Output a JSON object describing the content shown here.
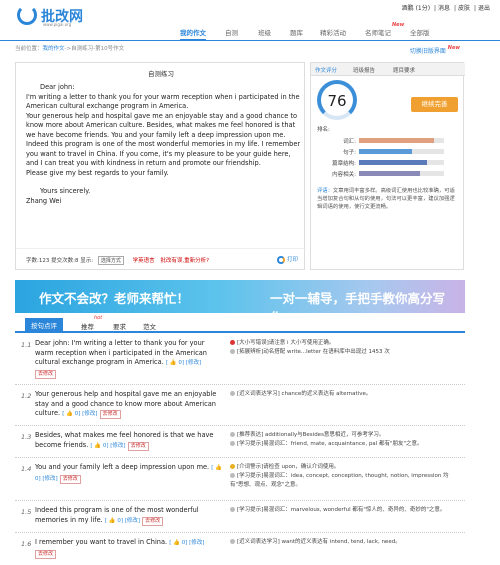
{
  "logo": {
    "text": "批改网",
    "url": "www.pigai.org"
  },
  "userbar": {
    "username": "酒鹏",
    "coins": "(1分)",
    "items": [
      "消息",
      "皮肤",
      "退出"
    ]
  },
  "nav": {
    "items": [
      "我的作文",
      "自测",
      "班级",
      "题库",
      "精彩活动",
      "名师笔记",
      "全部版"
    ],
    "new_label": "New"
  },
  "breadcrumb": {
    "home": "当前位置：",
    "link1": "我的作文",
    "rest": "->自测练习-第10号作文"
  },
  "switch_link": "切换旧版界面",
  "switch_new": "New",
  "essay": {
    "title": "自测练习",
    "paragraphs": [
      "Dear john:",
      "I'm writing a letter to thank you for your warm reception when i participated in the American cultural exchange program in America.",
      "Your generous help and hospital gave me an enjoyable stay and a good chance to know more about American culture. Besides, what makes me feel honored is that we have become friends. You and your family left a deep impression upon me. Indeed this program is one of the most wonderful memories in my life. I remember you want to travel in China. If you come, it's my pleasure to be your guide here, and I can treat you with kindness in return and promote our friendship.",
      "Please give my best regards to your family.",
      "Yours sincerely.",
      "Zhang Wei"
    ],
    "word_count": "字数:123",
    "submit_count": "提交次数:8",
    "display_label": "显示:",
    "select_value": "选择方式",
    "learn_english": "学英语言",
    "red_link": "批改有误,重新分析?",
    "print": "打印"
  },
  "side": {
    "tabs": [
      "作文评分",
      "班级报告",
      "题目要求"
    ],
    "score": "76",
    "improve_button": "继续完善",
    "rank_label": "排名:",
    "metrics": [
      {
        "label": "词汇:",
        "value": 0.88,
        "color": "#e0a080"
      },
      {
        "label": "句子:",
        "value": 0.62,
        "color": "#5a9ad9"
      },
      {
        "label": "篇章结构:",
        "value": 0.8,
        "color": "#5a7ab9"
      },
      {
        "label": "内容相关:",
        "value": 0.72,
        "color": "#8a8ab9"
      }
    ],
    "comment_label": "评语：",
    "comment": "文章用词丰富多样。高级词汇使用也比较准确，可适当增加复合句和从句的使用，句法可以更丰富，建议加强逻辑词语的使用，使行文更流畅。"
  },
  "banner": {
    "left": "作文不会改？老师来帮忙！",
    "right": "一对一辅导，手把手教你高分写作。"
  },
  "tabs2": {
    "items": [
      "按句点评",
      "推荐",
      "要求",
      "范文"
    ],
    "hot": "hot"
  },
  "rows": [
    {
      "num": "1.1",
      "text": "Dear john: I'm writing a letter to thank you for your warm reception when i participated in the American cultural exchange program in America.",
      "meta": "[ 👍 0] [修改]",
      "button": "去修改",
      "notes": [
        {
          "dot": "red",
          "text": "[大小写错误]请注意 i 大小写使用正确。"
        },
        {
          "dot": "gray",
          "text": "[拓展辨析]动名搭配 write...letter 在语料库中出现过 1453 次"
        }
      ]
    },
    {
      "num": "1.2",
      "text": "Your generous help and hospital gave me an enjoyable stay and a good chance to know more about American culture.",
      "meta": "[ 👍 0] [修改]",
      "button": "去修改",
      "notes": [
        {
          "dot": "gray",
          "text": "[近义词表达学习] chance的近义表达有 alternative。"
        }
      ]
    },
    {
      "num": "1.3",
      "text": "Besides, what makes me feel honored is that we have become friends.",
      "meta": "[ 👍 0] [修改]",
      "button": "去修改",
      "notes": [
        {
          "dot": "gray",
          "text": "[推荐表达] additionally与Besides意思相近，可参考学习。"
        },
        {
          "dot": "gray",
          "text": "[学习提示]易混词汇：friend, mate, acquaintance, pal 都有\"朋友\"之意。"
        }
      ]
    },
    {
      "num": "1.4",
      "text": "You and your family left a deep impression upon me.",
      "meta": "[ 👍 0] [修改]",
      "button": "去修改",
      "notes": [
        {
          "dot": "yellow",
          "text": "[介词警示]请检查 upon，确认介词使用。"
        },
        {
          "dot": "gray",
          "text": "[学习提示]易混词汇：idea, concept, conception, thought, notion, impression 均有\"思想、观点、观念\"之意。"
        }
      ]
    },
    {
      "num": "1.5",
      "text": "Indeed this program is one of the most wonderful memories in my life.",
      "meta": "[ 👍 0] [修改]",
      "button": "去修改",
      "notes": [
        {
          "dot": "gray",
          "text": "[学习提示]易混词汇：marvelous, wonderful 都有\"惊人的、奇异的、奇妙的\"之意。"
        }
      ]
    },
    {
      "num": "1.6",
      "text": "I remember you want to travel in China.",
      "meta": "[ 👍 0] [修改]",
      "button": "去修改",
      "notes": [
        {
          "dot": "gray",
          "text": "[近义词表达学习] want的近义表达有 intend, tend, lack, need。"
        }
      ]
    }
  ]
}
